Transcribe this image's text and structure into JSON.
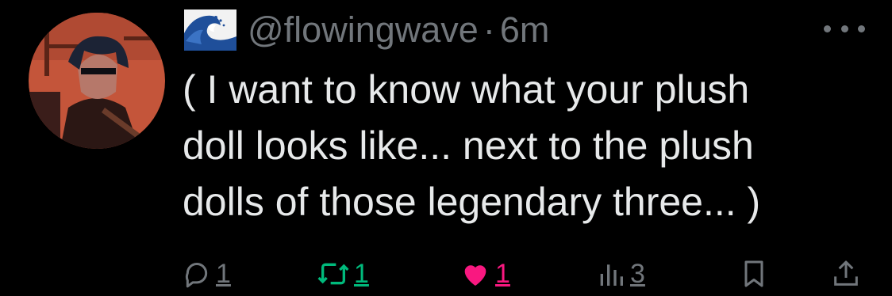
{
  "tweet": {
    "handle": "@flowingwave",
    "separator": "·",
    "time": "6m",
    "text_lines": [
      "( I want to know what your plush",
      "doll looks like... next to the plush",
      "dolls of those legendary three... )"
    ]
  },
  "icons": {
    "name_emoji": "water-wave-emoji",
    "more": "more-dots-icon",
    "reply": "reply-bubble-icon",
    "retweet": "retweet-icon",
    "like": "heart-icon",
    "views": "views-bars-icon",
    "bookmark": "bookmark-icon",
    "share": "share-icon"
  },
  "actions": {
    "reply_count": "1",
    "retweet_count": "1",
    "like_count": "1",
    "views_count": "3"
  },
  "colors": {
    "background": "#000000",
    "text": "#e7e9ea",
    "muted": "#71767b",
    "retweet": "#00ba7c",
    "like": "#f91880"
  }
}
